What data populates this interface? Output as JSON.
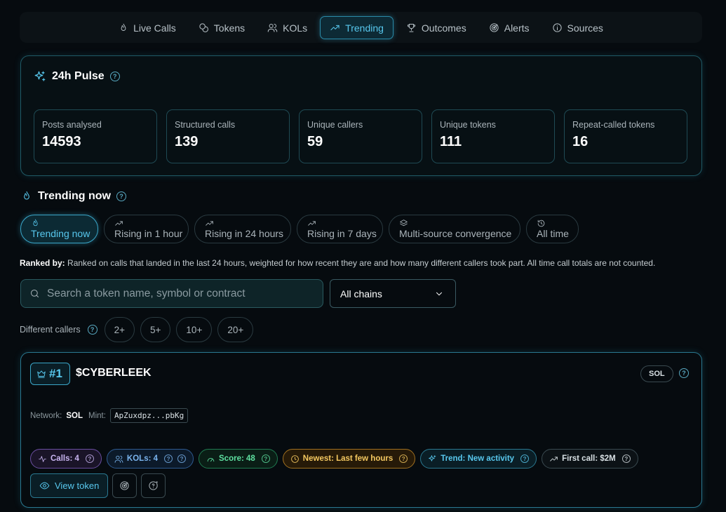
{
  "nav": {
    "tabs": [
      {
        "label": "Live Calls",
        "icon": "flame-icon"
      },
      {
        "label": "Tokens",
        "icon": "coins-icon"
      },
      {
        "label": "KOLs",
        "icon": "users-icon"
      },
      {
        "label": "Trending",
        "icon": "trending-up-icon"
      },
      {
        "label": "Outcomes",
        "icon": "trophy-icon"
      },
      {
        "label": "Alerts",
        "icon": "radar-icon"
      },
      {
        "label": "Sources",
        "icon": "info-icon"
      }
    ],
    "active": "Trending"
  },
  "pulse": {
    "title": "24h Pulse",
    "stats": [
      {
        "label": "Posts analysed",
        "value": "14593"
      },
      {
        "label": "Structured calls",
        "value": "139"
      },
      {
        "label": "Unique callers",
        "value": "59"
      },
      {
        "label": "Unique tokens",
        "value": "111"
      },
      {
        "label": "Repeat-called tokens",
        "value": "16"
      }
    ]
  },
  "trending": {
    "title": "Trending now",
    "filters": [
      {
        "label": "Trending now",
        "icon": "flame-icon"
      },
      {
        "label": "Rising in 1 hour",
        "icon": "trending-up-icon"
      },
      {
        "label": "Rising in 24 hours",
        "icon": "trending-up-icon"
      },
      {
        "label": "Rising in 7 days",
        "icon": "trending-up-icon"
      },
      {
        "label": "Multi-source convergence",
        "icon": "layers-icon"
      },
      {
        "label": "All time",
        "icon": "history-icon"
      }
    ],
    "active_filter": "Trending now",
    "ranked_by_label": "Ranked by:",
    "ranked_by_text": "Ranked on calls that landed in the last 24 hours, weighted for how recent they are and how many different callers took part. All time call totals are not counted."
  },
  "search": {
    "placeholder": "Search a token name, symbol or contract",
    "value": ""
  },
  "chain_select": {
    "value": "All chains"
  },
  "callers_filter": {
    "label": "Different callers",
    "options": [
      "2+",
      "5+",
      "10+",
      "20+"
    ]
  },
  "token_card": {
    "rank": "#1",
    "name": "$CYBERLEEK",
    "chain": "SOL",
    "network_label": "Network:",
    "network_value": "SOL",
    "mint_label": "Mint:",
    "mint_value": "ApZuxdpz...pbKg",
    "badges": {
      "calls": "Calls: 4",
      "kols": "KOLs: 4",
      "score": "Score: 48",
      "newest": "Newest: Last few hours",
      "trend": "Trend: New activity",
      "first_call": "First call: $2M"
    },
    "view_button": "View token"
  },
  "colors": {
    "accent": "#58c8ee",
    "background": "#060b0f",
    "score_green": "#5ee0a0",
    "newest_amber": "#f4c860",
    "calls_purple": "#c8b4f0"
  }
}
